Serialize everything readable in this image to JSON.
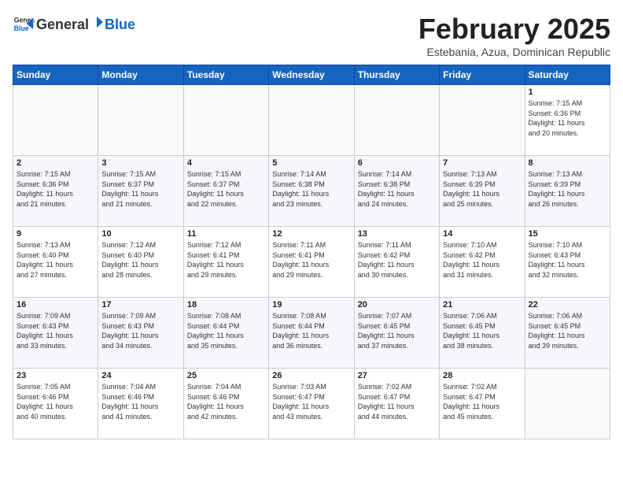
{
  "header": {
    "logo_general": "General",
    "logo_blue": "Blue",
    "month_title": "February 2025",
    "location": "Estebania, Azua, Dominican Republic"
  },
  "weekdays": [
    "Sunday",
    "Monday",
    "Tuesday",
    "Wednesday",
    "Thursday",
    "Friday",
    "Saturday"
  ],
  "weeks": [
    [
      {
        "day": "",
        "info": ""
      },
      {
        "day": "",
        "info": ""
      },
      {
        "day": "",
        "info": ""
      },
      {
        "day": "",
        "info": ""
      },
      {
        "day": "",
        "info": ""
      },
      {
        "day": "",
        "info": ""
      },
      {
        "day": "1",
        "info": "Sunrise: 7:15 AM\nSunset: 6:36 PM\nDaylight: 11 hours\nand 20 minutes."
      }
    ],
    [
      {
        "day": "2",
        "info": "Sunrise: 7:15 AM\nSunset: 6:36 PM\nDaylight: 11 hours\nand 21 minutes."
      },
      {
        "day": "3",
        "info": "Sunrise: 7:15 AM\nSunset: 6:37 PM\nDaylight: 11 hours\nand 21 minutes."
      },
      {
        "day": "4",
        "info": "Sunrise: 7:15 AM\nSunset: 6:37 PM\nDaylight: 11 hours\nand 22 minutes."
      },
      {
        "day": "5",
        "info": "Sunrise: 7:14 AM\nSunset: 6:38 PM\nDaylight: 11 hours\nand 23 minutes."
      },
      {
        "day": "6",
        "info": "Sunrise: 7:14 AM\nSunset: 6:38 PM\nDaylight: 11 hours\nand 24 minutes."
      },
      {
        "day": "7",
        "info": "Sunrise: 7:13 AM\nSunset: 6:39 PM\nDaylight: 11 hours\nand 25 minutes."
      },
      {
        "day": "8",
        "info": "Sunrise: 7:13 AM\nSunset: 6:39 PM\nDaylight: 11 hours\nand 26 minutes."
      }
    ],
    [
      {
        "day": "9",
        "info": "Sunrise: 7:13 AM\nSunset: 6:40 PM\nDaylight: 11 hours\nand 27 minutes."
      },
      {
        "day": "10",
        "info": "Sunrise: 7:12 AM\nSunset: 6:40 PM\nDaylight: 11 hours\nand 28 minutes."
      },
      {
        "day": "11",
        "info": "Sunrise: 7:12 AM\nSunset: 6:41 PM\nDaylight: 11 hours\nand 29 minutes."
      },
      {
        "day": "12",
        "info": "Sunrise: 7:11 AM\nSunset: 6:41 PM\nDaylight: 11 hours\nand 29 minutes."
      },
      {
        "day": "13",
        "info": "Sunrise: 7:11 AM\nSunset: 6:42 PM\nDaylight: 11 hours\nand 30 minutes."
      },
      {
        "day": "14",
        "info": "Sunrise: 7:10 AM\nSunset: 6:42 PM\nDaylight: 11 hours\nand 31 minutes."
      },
      {
        "day": "15",
        "info": "Sunrise: 7:10 AM\nSunset: 6:43 PM\nDaylight: 11 hours\nand 32 minutes."
      }
    ],
    [
      {
        "day": "16",
        "info": "Sunrise: 7:09 AM\nSunset: 6:43 PM\nDaylight: 11 hours\nand 33 minutes."
      },
      {
        "day": "17",
        "info": "Sunrise: 7:09 AM\nSunset: 6:43 PM\nDaylight: 11 hours\nand 34 minutes."
      },
      {
        "day": "18",
        "info": "Sunrise: 7:08 AM\nSunset: 6:44 PM\nDaylight: 11 hours\nand 35 minutes."
      },
      {
        "day": "19",
        "info": "Sunrise: 7:08 AM\nSunset: 6:44 PM\nDaylight: 11 hours\nand 36 minutes."
      },
      {
        "day": "20",
        "info": "Sunrise: 7:07 AM\nSunset: 6:45 PM\nDaylight: 11 hours\nand 37 minutes."
      },
      {
        "day": "21",
        "info": "Sunrise: 7:06 AM\nSunset: 6:45 PM\nDaylight: 11 hours\nand 38 minutes."
      },
      {
        "day": "22",
        "info": "Sunrise: 7:06 AM\nSunset: 6:45 PM\nDaylight: 11 hours\nand 39 minutes."
      }
    ],
    [
      {
        "day": "23",
        "info": "Sunrise: 7:05 AM\nSunset: 6:46 PM\nDaylight: 11 hours\nand 40 minutes."
      },
      {
        "day": "24",
        "info": "Sunrise: 7:04 AM\nSunset: 6:46 PM\nDaylight: 11 hours\nand 41 minutes."
      },
      {
        "day": "25",
        "info": "Sunrise: 7:04 AM\nSunset: 6:46 PM\nDaylight: 11 hours\nand 42 minutes."
      },
      {
        "day": "26",
        "info": "Sunrise: 7:03 AM\nSunset: 6:47 PM\nDaylight: 11 hours\nand 43 minutes."
      },
      {
        "day": "27",
        "info": "Sunrise: 7:02 AM\nSunset: 6:47 PM\nDaylight: 11 hours\nand 44 minutes."
      },
      {
        "day": "28",
        "info": "Sunrise: 7:02 AM\nSunset: 6:47 PM\nDaylight: 11 hours\nand 45 minutes."
      },
      {
        "day": "",
        "info": ""
      }
    ]
  ]
}
